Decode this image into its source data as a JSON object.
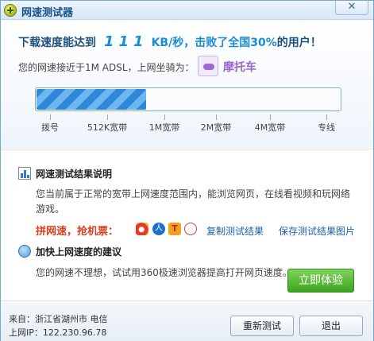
{
  "window": {
    "title": "网速测试器",
    "close_label": "✕"
  },
  "result": {
    "headline_prefix": "下载速度能达到",
    "speed_value": "111",
    "headline_mid": "KB/秒，击败了全国",
    "beat_percent": "30%",
    "headline_suffix": "的用户！",
    "adsl_text": "您的网速接近于1M ADSL，上网坐骑为：",
    "vehicle_label": "摩托车",
    "progress_fraction": 0.36
  },
  "scale": {
    "labels": [
      "拨号",
      "512K宽带",
      "1M宽带",
      "2M宽带",
      "4M宽带",
      "专线"
    ]
  },
  "explanation": {
    "title": "网速测试结果说明",
    "body": "您当前属于正常的宽带上网速度范围内，能浏览网页，在线看视频和玩网络游戏。"
  },
  "promo": {
    "label": "拼网速，抢机票：",
    "social_icons": [
      "weibo-icon",
      "renren-icon",
      "tianya-icon",
      "map-pin-icon"
    ],
    "copy_link": "复制测试结果",
    "save_link": "保存测试结果图片"
  },
  "advice": {
    "title": "加快上网速度的建议",
    "body": "您的网速不理想，试试用360极速浏览器提高打开网页速度。",
    "try_button": "立即体验"
  },
  "footer": {
    "location": "来自：浙江省湖州市 电信",
    "ip": "上网IP：122.230.96.78",
    "retest_button": "重新测试",
    "exit_button": "退出"
  },
  "colors": {
    "accent_blue": "#1a8bd5",
    "promo_red": "#d8401f",
    "vehicle_purple": "#9b67cf",
    "button_green": "#3ea51f"
  }
}
